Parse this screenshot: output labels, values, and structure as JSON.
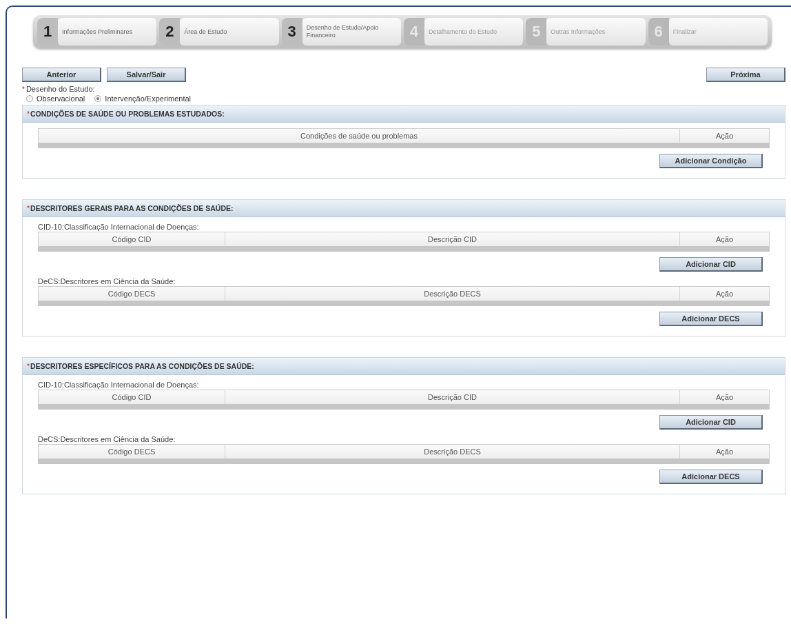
{
  "steps": [
    {
      "number": "1",
      "label": "Informações Preliminares",
      "disabled": false
    },
    {
      "number": "2",
      "label": "Área de Estudo",
      "disabled": false
    },
    {
      "number": "3",
      "label": "Desenho de Estudo/Apoio Financeiro",
      "disabled": false
    },
    {
      "number": "4",
      "label": "Detalhamento do Estudo",
      "disabled": true
    },
    {
      "number": "5",
      "label": "Outras Informações",
      "disabled": true
    },
    {
      "number": "6",
      "label": "Finalizar",
      "disabled": true
    }
  ],
  "nav_buttons": {
    "left": [
      "Anterior",
      "Salvar/Sair"
    ],
    "right": [
      "Próxima"
    ]
  },
  "study_design": {
    "marker": "*",
    "label": "Desenho do Estudo:",
    "options": [
      {
        "label": "Observacional",
        "selected": false
      },
      {
        "label": "Intervenção/Experimental",
        "selected": true
      }
    ]
  },
  "sections": [
    {
      "marker": "*",
      "title": "CONDIÇÕES DE SAÚDE OU PROBLEMAS ESTUDADOS:",
      "tables": [
        {
          "columns": [
            "Condições de saúde ou problemas",
            "Ação"
          ],
          "button": "Adicionar Condição"
        }
      ]
    },
    {
      "marker": "*",
      "title": "DESCRITORES GERAIS PARA AS CONDIÇÕES DE SAÚDE:",
      "tables": [
        {
          "caption": "CID-10:Classificação Internacional de Doenças:",
          "columns": [
            "Código CID",
            "Descrição CID",
            "Ação"
          ],
          "button": "Adicionar CID"
        },
        {
          "caption": "DeCS:Descritores em Ciência da Saúde:",
          "columns": [
            "Código DECS",
            "Descrição DECS",
            "Ação"
          ],
          "button": "Adicionar DECS"
        }
      ]
    },
    {
      "marker": "*",
      "title": "DESCRITORES ESPECÍFICOS PARA AS CONDIÇÕES DE SAÚDE:",
      "tables": [
        {
          "caption": "CID-10:Classificação Internacional de Doenças:",
          "columns": [
            "Código CID",
            "Descrição CID",
            "Ação"
          ],
          "button": "Adicionar CID"
        },
        {
          "caption": "DeCS:Descritores em Ciência da Saúde:",
          "columns": [
            "Código DECS",
            "Descrição DECS",
            "Ação"
          ],
          "button": "Adicionar DECS"
        }
      ]
    }
  ]
}
